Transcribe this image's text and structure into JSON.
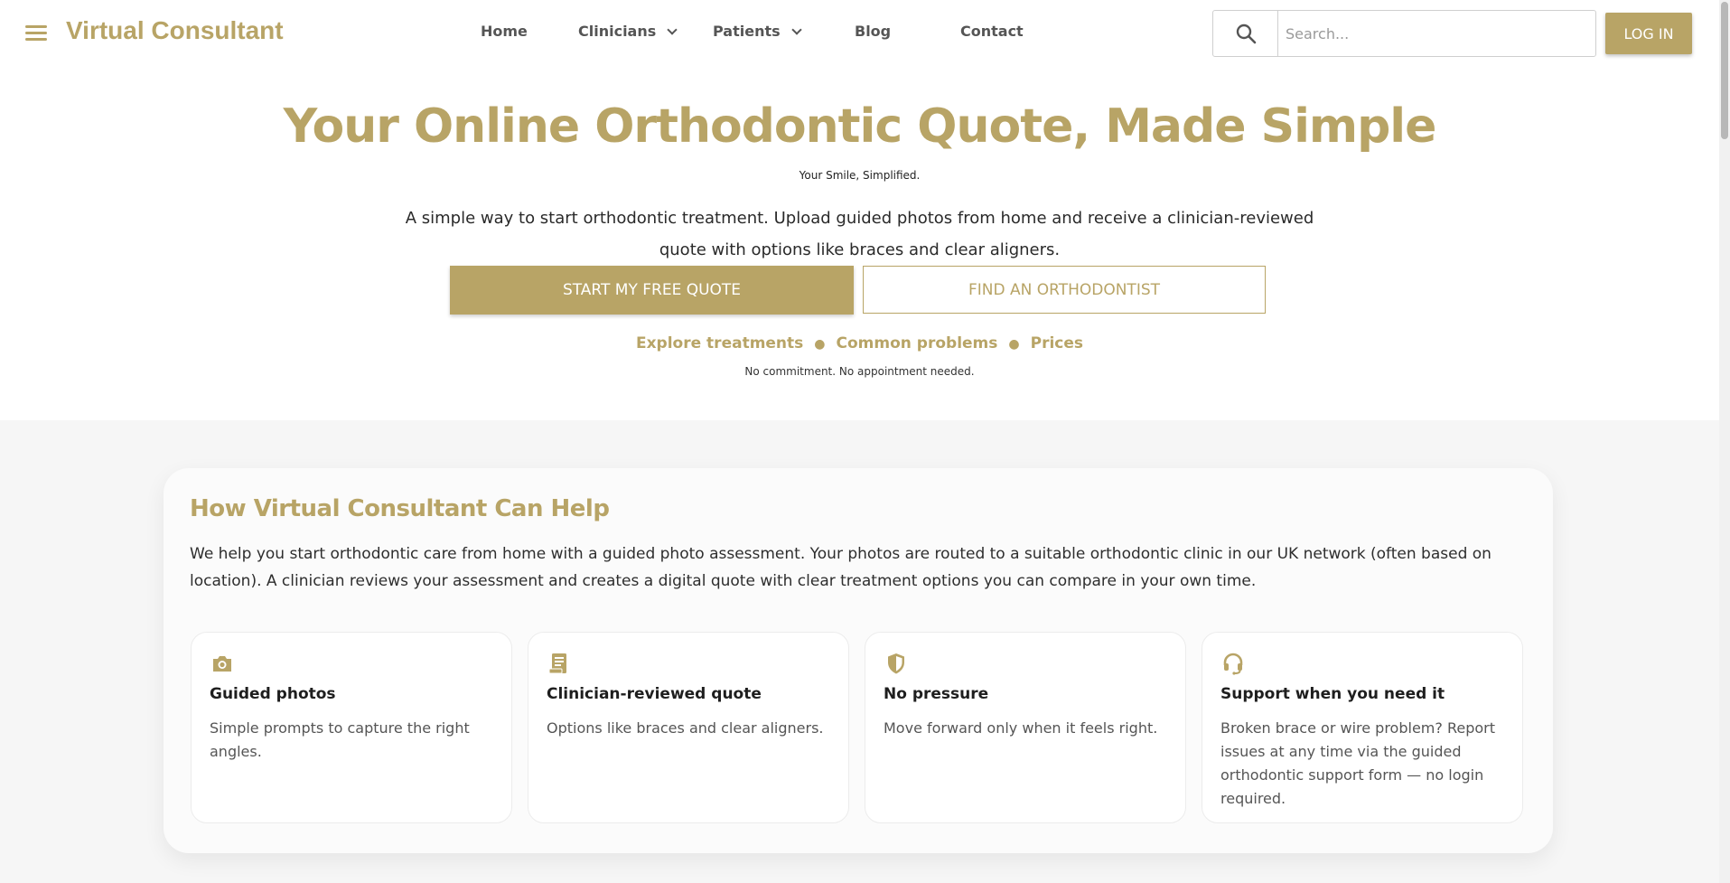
{
  "header": {
    "brand": "Virtual Consultant",
    "nav": [
      {
        "label": "Home"
      },
      {
        "label": "Clinicians",
        "dropdown": true
      },
      {
        "label": "Patients",
        "dropdown": true
      },
      {
        "label": "Blog"
      },
      {
        "label": "Contact"
      }
    ],
    "search": {
      "placeholder": "Search...",
      "value": ""
    },
    "login_label": "LOG IN"
  },
  "hero": {
    "title": "Your Online Orthodontic Quote, Made Simple",
    "tagline": "Your Smile, Simplified.",
    "description": "A simple way to start orthodontic treatment. Upload guided photos from home and receive a clinician-reviewed quote with options like braces and clear aligners.",
    "primary_cta": "START MY FREE QUOTE",
    "secondary_cta": "FIND AN ORTHODONTIST",
    "links": [
      "Explore treatments",
      "Common problems",
      "Prices"
    ],
    "note": "No commitment. No appointment needed."
  },
  "help": {
    "title": "How Virtual Consultant Can Help",
    "text": "We help you start orthodontic care from home with a guided photo assessment. Your photos are routed to a suitable orthodontic clinic in our UK network (often based on location). A clinician reviews your assessment and creates a digital quote with clear treatment options you can compare in your own time.",
    "cards": [
      {
        "icon": "camera-icon",
        "title": "Guided photos",
        "text": "Simple prompts to capture the right angles."
      },
      {
        "icon": "document-icon",
        "title": "Clinician-reviewed quote",
        "text": "Options like braces and clear aligners."
      },
      {
        "icon": "shield-icon",
        "title": "No pressure",
        "text": "Move forward only when it feels right."
      },
      {
        "icon": "headset-icon",
        "title": "Support when you need it",
        "text": "Broken brace or wire problem? Report issues at any time via the guided orthodontic support form — no login required."
      }
    ]
  },
  "colors": {
    "accent": "#b8a466",
    "section_bg": "#f6f6f6"
  }
}
